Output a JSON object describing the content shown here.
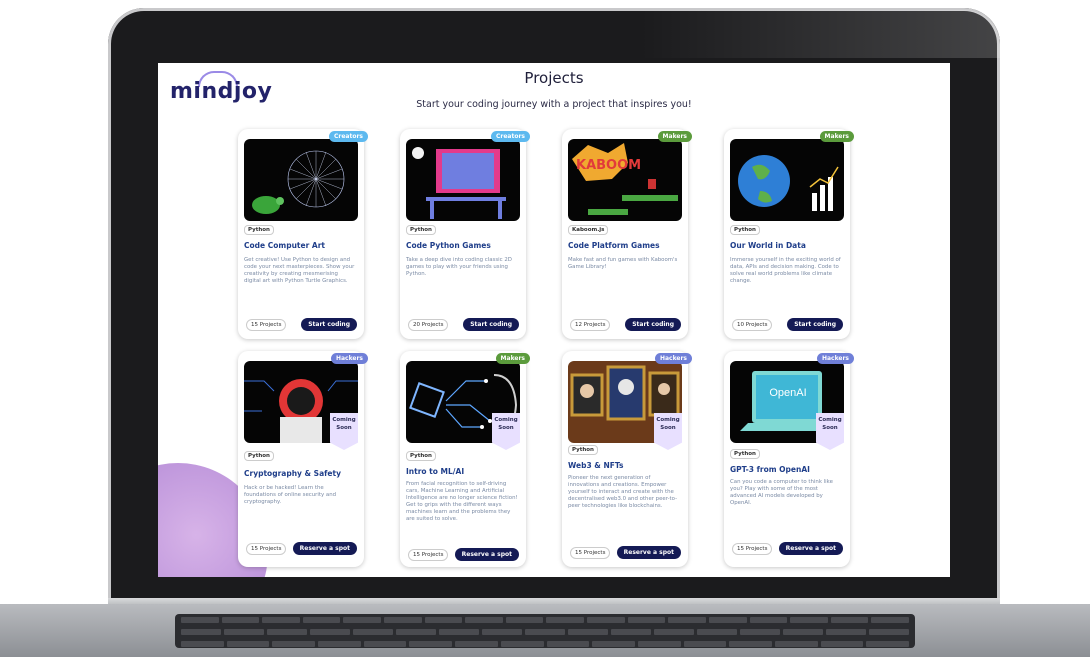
{
  "header": {
    "logo_text": "mindjoy",
    "title": "Projects",
    "subtitle": "Start your coding journey with a project that inspires you!"
  },
  "cards": [
    {
      "badge": "Creators",
      "language": "Python",
      "title": "Code Computer Art",
      "description": "Get creative! Use Python to design and code your next masterpieces. Show your creativity by creating mesmerising digital art with Python Turtle Graphics.",
      "count": "15 Projects",
      "button": "Start coding"
    },
    {
      "badge": "Creators",
      "language": "Python",
      "title": "Code Python Games",
      "description": "Take a deep dive into coding classic 2D games to play with your friends using Python.",
      "count": "20 Projects",
      "button": "Start coding"
    },
    {
      "badge": "Makers",
      "language": "Kaboom.js",
      "title": "Code Platform Games",
      "description": "Make fast and fun games with Kaboom's Game Library!",
      "count": "12 Projects",
      "button": "Start coding"
    },
    {
      "badge": "Makers",
      "language": "Python",
      "title": "Our World in Data",
      "description": "Immerse yourself in the exciting world of data, APIs and decision making. Code to solve real world problems like climate change.",
      "count": "10 Projects",
      "button": "Start coding"
    },
    {
      "badge": "Hackers",
      "language": "Python",
      "title": "Cryptography & Safety",
      "description": "Hack or be hacked! Learn the foundations of online security and cryptography.",
      "count": "15 Projects",
      "button": "Reserve a spot",
      "soon": "Coming Soon"
    },
    {
      "badge": "Makers",
      "language": "Python",
      "title": "Intro to ML/AI",
      "description": "From facial recognition to self-driving cars, Machine Learning and Artificial Intelligence are no longer science fiction! Get to grips with the different ways machines learn and the problems they are suited to solve.",
      "count": "15 Projects",
      "button": "Reserve a spot",
      "soon": "Coming Soon"
    },
    {
      "badge": "Hackers",
      "language": "Python",
      "title": "Web3 & NFTs",
      "description": "Pioneer the next generation of innovations and creations. Empower yourself to interact and create with the decentralised web3.0 and other peer-to-peer technologies like blockchains.",
      "count": "15 Projects",
      "button": "Reserve a spot",
      "soon": "Coming Soon"
    },
    {
      "badge": "Hackers",
      "language": "Python",
      "title": "GPT-3 from OpenAI",
      "description": "Can you code a computer to think like you? Play with some of the most advanced AI models developed by OpenAI.",
      "count": "15 Projects",
      "button": "Reserve a spot",
      "soon": "Coming Soon",
      "thumb_text": "OpenAI"
    }
  ],
  "extras": {
    "kaboom_text": "KABOOM"
  }
}
